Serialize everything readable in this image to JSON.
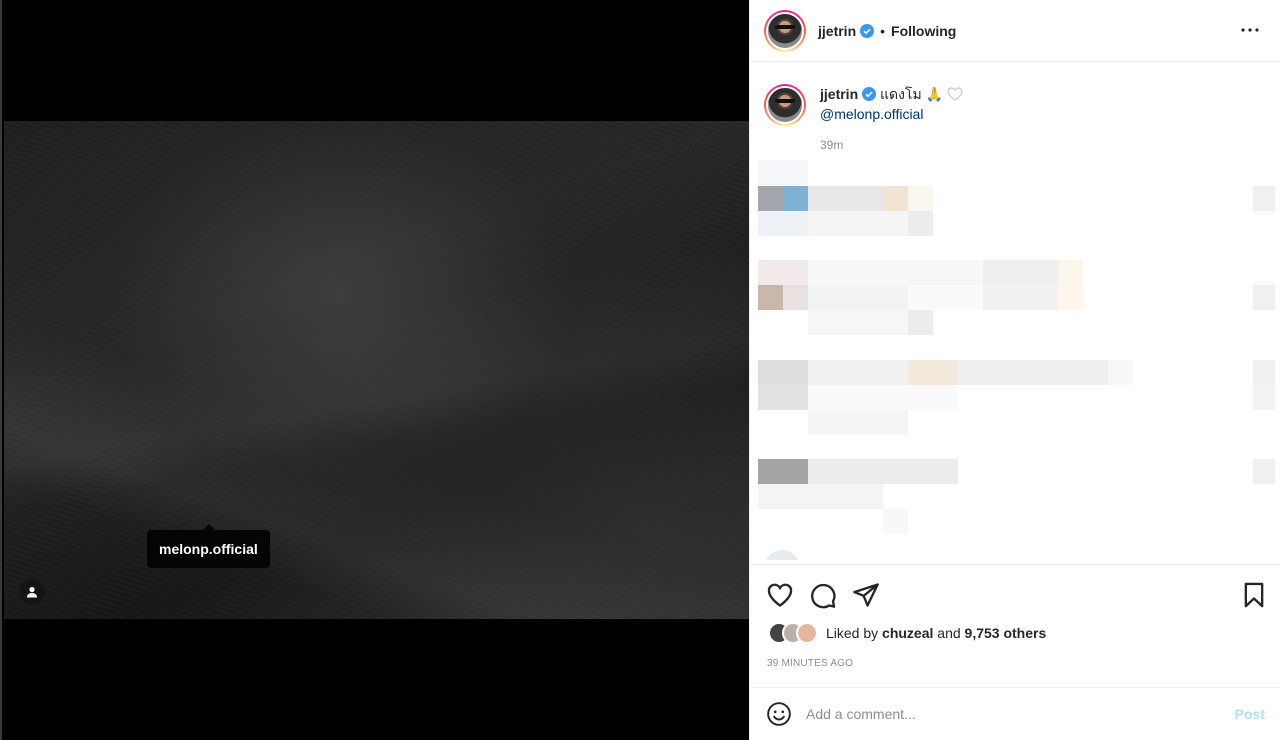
{
  "post": {
    "username": "jjetrin",
    "follow_status": "Following",
    "separator": "•",
    "photo_tag": "melonp.official"
  },
  "caption": {
    "username": "jjetrin",
    "text": "แดงโม",
    "emoji": "🙏",
    "mention": "@melonp.official",
    "time": "39m"
  },
  "likes": {
    "prefix": "Liked by",
    "user": "chuzeal",
    "and": "and",
    "count": "9,753 others"
  },
  "timestamp": "39 MINUTES AGO",
  "comment": {
    "placeholder": "Add a comment...",
    "post_label": "Post"
  },
  "colors": {
    "link": "#00376b",
    "post_disabled": "#b2dffc",
    "verified": "#3897f0"
  }
}
